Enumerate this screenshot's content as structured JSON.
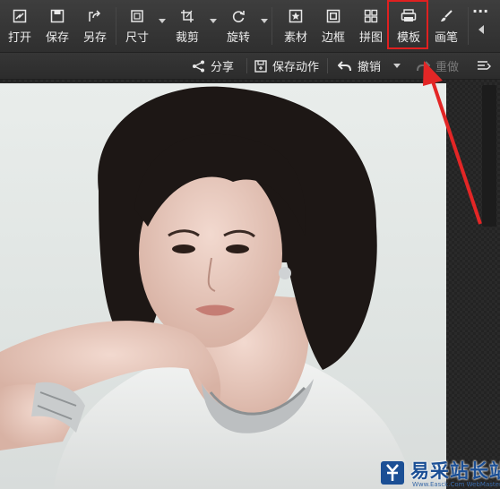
{
  "toolbar": {
    "tools": [
      {
        "id": "open",
        "label": "打开",
        "icon": "open-icon"
      },
      {
        "id": "save",
        "label": "保存",
        "icon": "save-icon"
      },
      {
        "id": "saveas",
        "label": "另存",
        "icon": "save-as-icon"
      },
      {
        "id": "size",
        "label": "尺寸",
        "icon": "resize-icon"
      },
      {
        "id": "crop",
        "label": "裁剪",
        "icon": "crop-icon"
      },
      {
        "id": "rotate",
        "label": "旋转",
        "icon": "rotate-icon"
      },
      {
        "id": "material",
        "label": "素材",
        "icon": "star-icon"
      },
      {
        "id": "border",
        "label": "边框",
        "icon": "frame-icon"
      },
      {
        "id": "collage",
        "label": "拼图",
        "icon": "grid-icon"
      },
      {
        "id": "template",
        "label": "模板",
        "icon": "template-icon"
      },
      {
        "id": "brush",
        "label": "画笔",
        "icon": "brush-icon"
      }
    ],
    "more_label": "···"
  },
  "actionbar": {
    "share_label": "分享",
    "save_action_label": "保存动作",
    "undo_label": "撤销",
    "redo_label": "重做"
  },
  "watermark": {
    "text": "易采站长站",
    "sub": "Www.Easck.Com WebMaster"
  },
  "colors": {
    "highlight": "#e02020",
    "arrow": "#e32626",
    "toolbar_bg": "#3a3a3a",
    "watermark_blue": "#1b4f95"
  }
}
